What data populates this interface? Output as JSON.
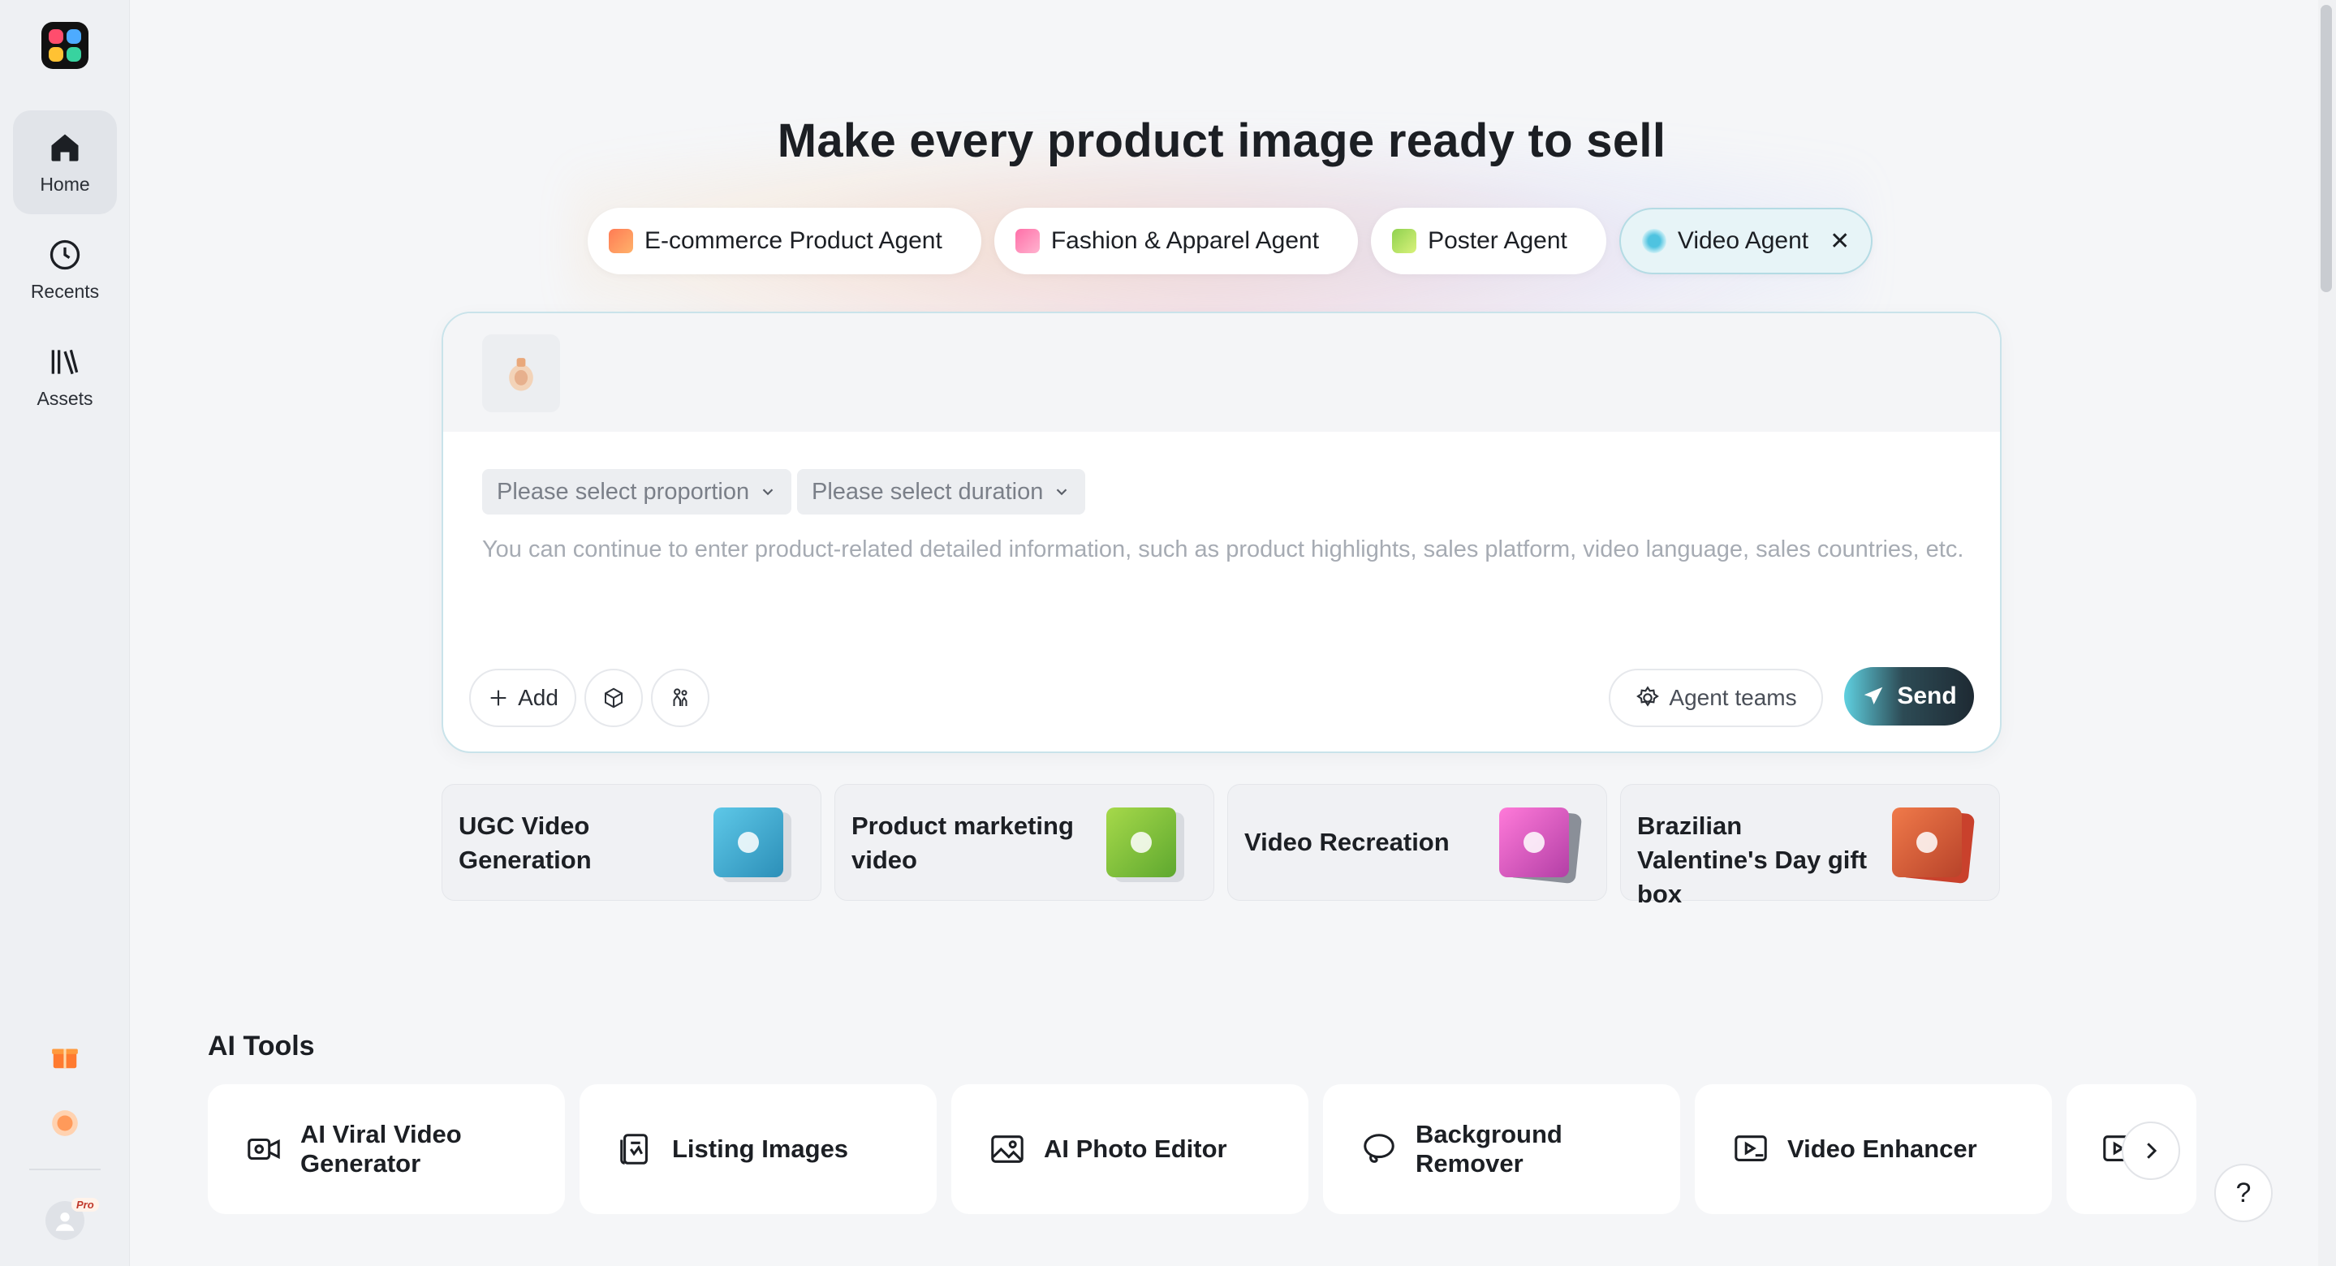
{
  "sidebar": {
    "nav": [
      {
        "label": "Home",
        "icon": "home-icon",
        "active": true
      },
      {
        "label": "Recents",
        "icon": "clock-icon",
        "active": false
      },
      {
        "label": "Assets",
        "icon": "library-icon",
        "active": false
      }
    ],
    "bottom_icons": [
      "gift-icon",
      "coin-icon"
    ],
    "avatar_badge": "Pro"
  },
  "hero": {
    "title": "Make every product image ready to sell"
  },
  "agent_tabs": [
    {
      "label": "E-commerce Product Agent",
      "icon": "sofa-icon"
    },
    {
      "label": "Fashion & Apparel Agent",
      "icon": "shirt-icon"
    },
    {
      "label": "Poster Agent",
      "icon": "poster-icon"
    },
    {
      "label": "Video Agent",
      "icon": "video-agent-icon",
      "selected": true
    }
  ],
  "composer": {
    "proportion_placeholder": "Please select proportion",
    "duration_placeholder": "Please select duration",
    "input_placeholder": "You can continue to enter product-related detailed information, such as product highlights, sales platform, video language, sales countries, etc.",
    "add_label": "Add",
    "agent_teams_label": "Agent teams",
    "send_label": "Send"
  },
  "suggestions": [
    {
      "label": "UGC Video Generation"
    },
    {
      "label": "Product marketing video"
    },
    {
      "label": "Video Recreation"
    },
    {
      "label": "Brazilian Valentine's Day gift box"
    }
  ],
  "ai_tools": {
    "title": "AI Tools",
    "items": [
      {
        "label": "AI Viral Video Generator",
        "icon": "video-camera-icon"
      },
      {
        "label": "Listing Images",
        "icon": "listing-icon"
      },
      {
        "label": "AI Photo Editor",
        "icon": "photo-icon"
      },
      {
        "label": "Background Remover",
        "icon": "lasso-icon"
      },
      {
        "label": "Video Enhancer",
        "icon": "hd-video-icon"
      }
    ]
  },
  "help_label": "?",
  "colors": {
    "accent": "#5fd0e0",
    "send_dark": "#1e2a33",
    "selected_tab_bg": "#e7f4f7"
  }
}
